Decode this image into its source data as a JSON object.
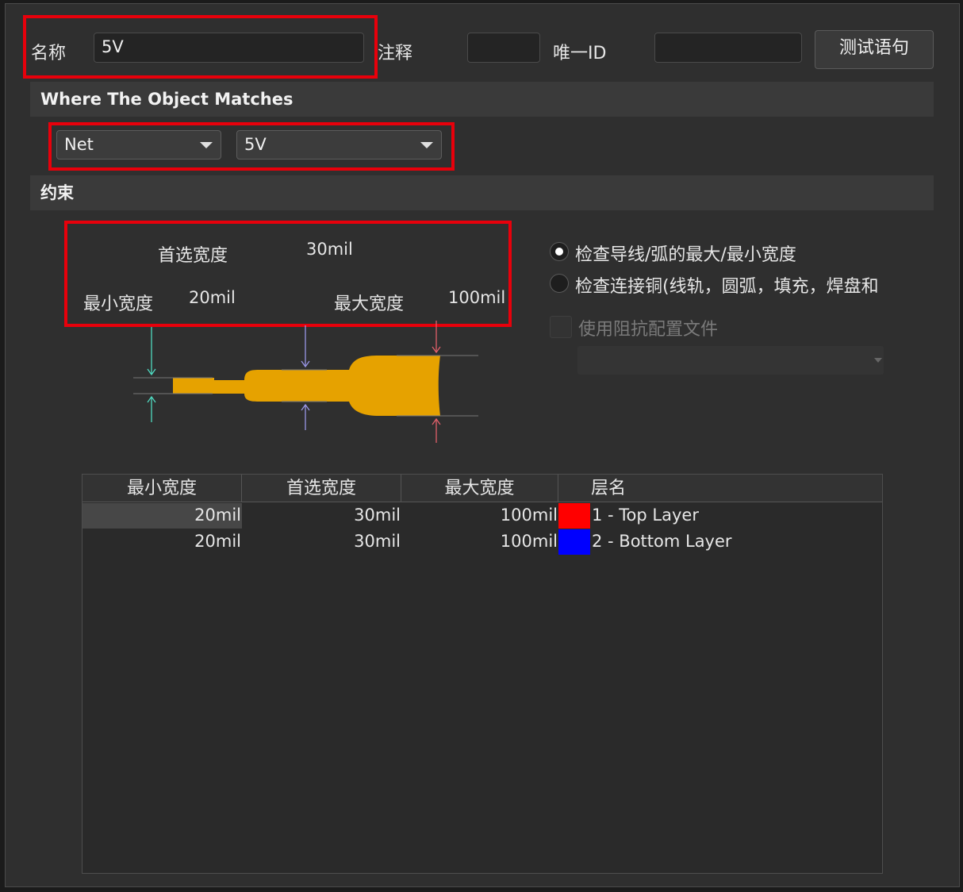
{
  "header": {
    "name_label": "名称",
    "name_value": "5V",
    "comment_label": "注释",
    "comment_value": "",
    "uid_label": "唯一ID",
    "uid_value": "",
    "test_button": "测试语句"
  },
  "match": {
    "section_title": "Where The Object Matches",
    "type_value": "Net",
    "net_value": "5V"
  },
  "constraints": {
    "section_title": "约束",
    "preferred_label": "首选宽度",
    "preferred_value": "30mil",
    "min_label": "最小宽度",
    "min_value": "20mil",
    "max_label": "最大宽度",
    "max_value": "100mil",
    "radio_track_label": "检查导线/弧的最大/最小宽度",
    "radio_track_selected": true,
    "radio_copper_label": "检查连接铜(线轨，圆弧，填充，焊盘和",
    "radio_copper_selected": false,
    "impedance_label": "使用阻抗配置文件",
    "impedance_checked": false,
    "impedance_profile_value": ""
  },
  "diagram_colors": {
    "trace": "#e6a200",
    "min_arrow": "#4fd9c0",
    "pref_arrow": "#9a96e6",
    "max_arrow": "#e0606a"
  },
  "table": {
    "headers": [
      "最小宽度",
      "首选宽度",
      "最大宽度",
      "层名"
    ],
    "rows": [
      {
        "min": "20mil",
        "pref": "30mil",
        "max": "100mil",
        "color": "#ff0000",
        "layer": "1 - Top Layer"
      },
      {
        "min": "20mil",
        "pref": "30mil",
        "max": "100mil",
        "color": "#0000ff",
        "layer": "2 - Bottom Layer"
      }
    ]
  }
}
